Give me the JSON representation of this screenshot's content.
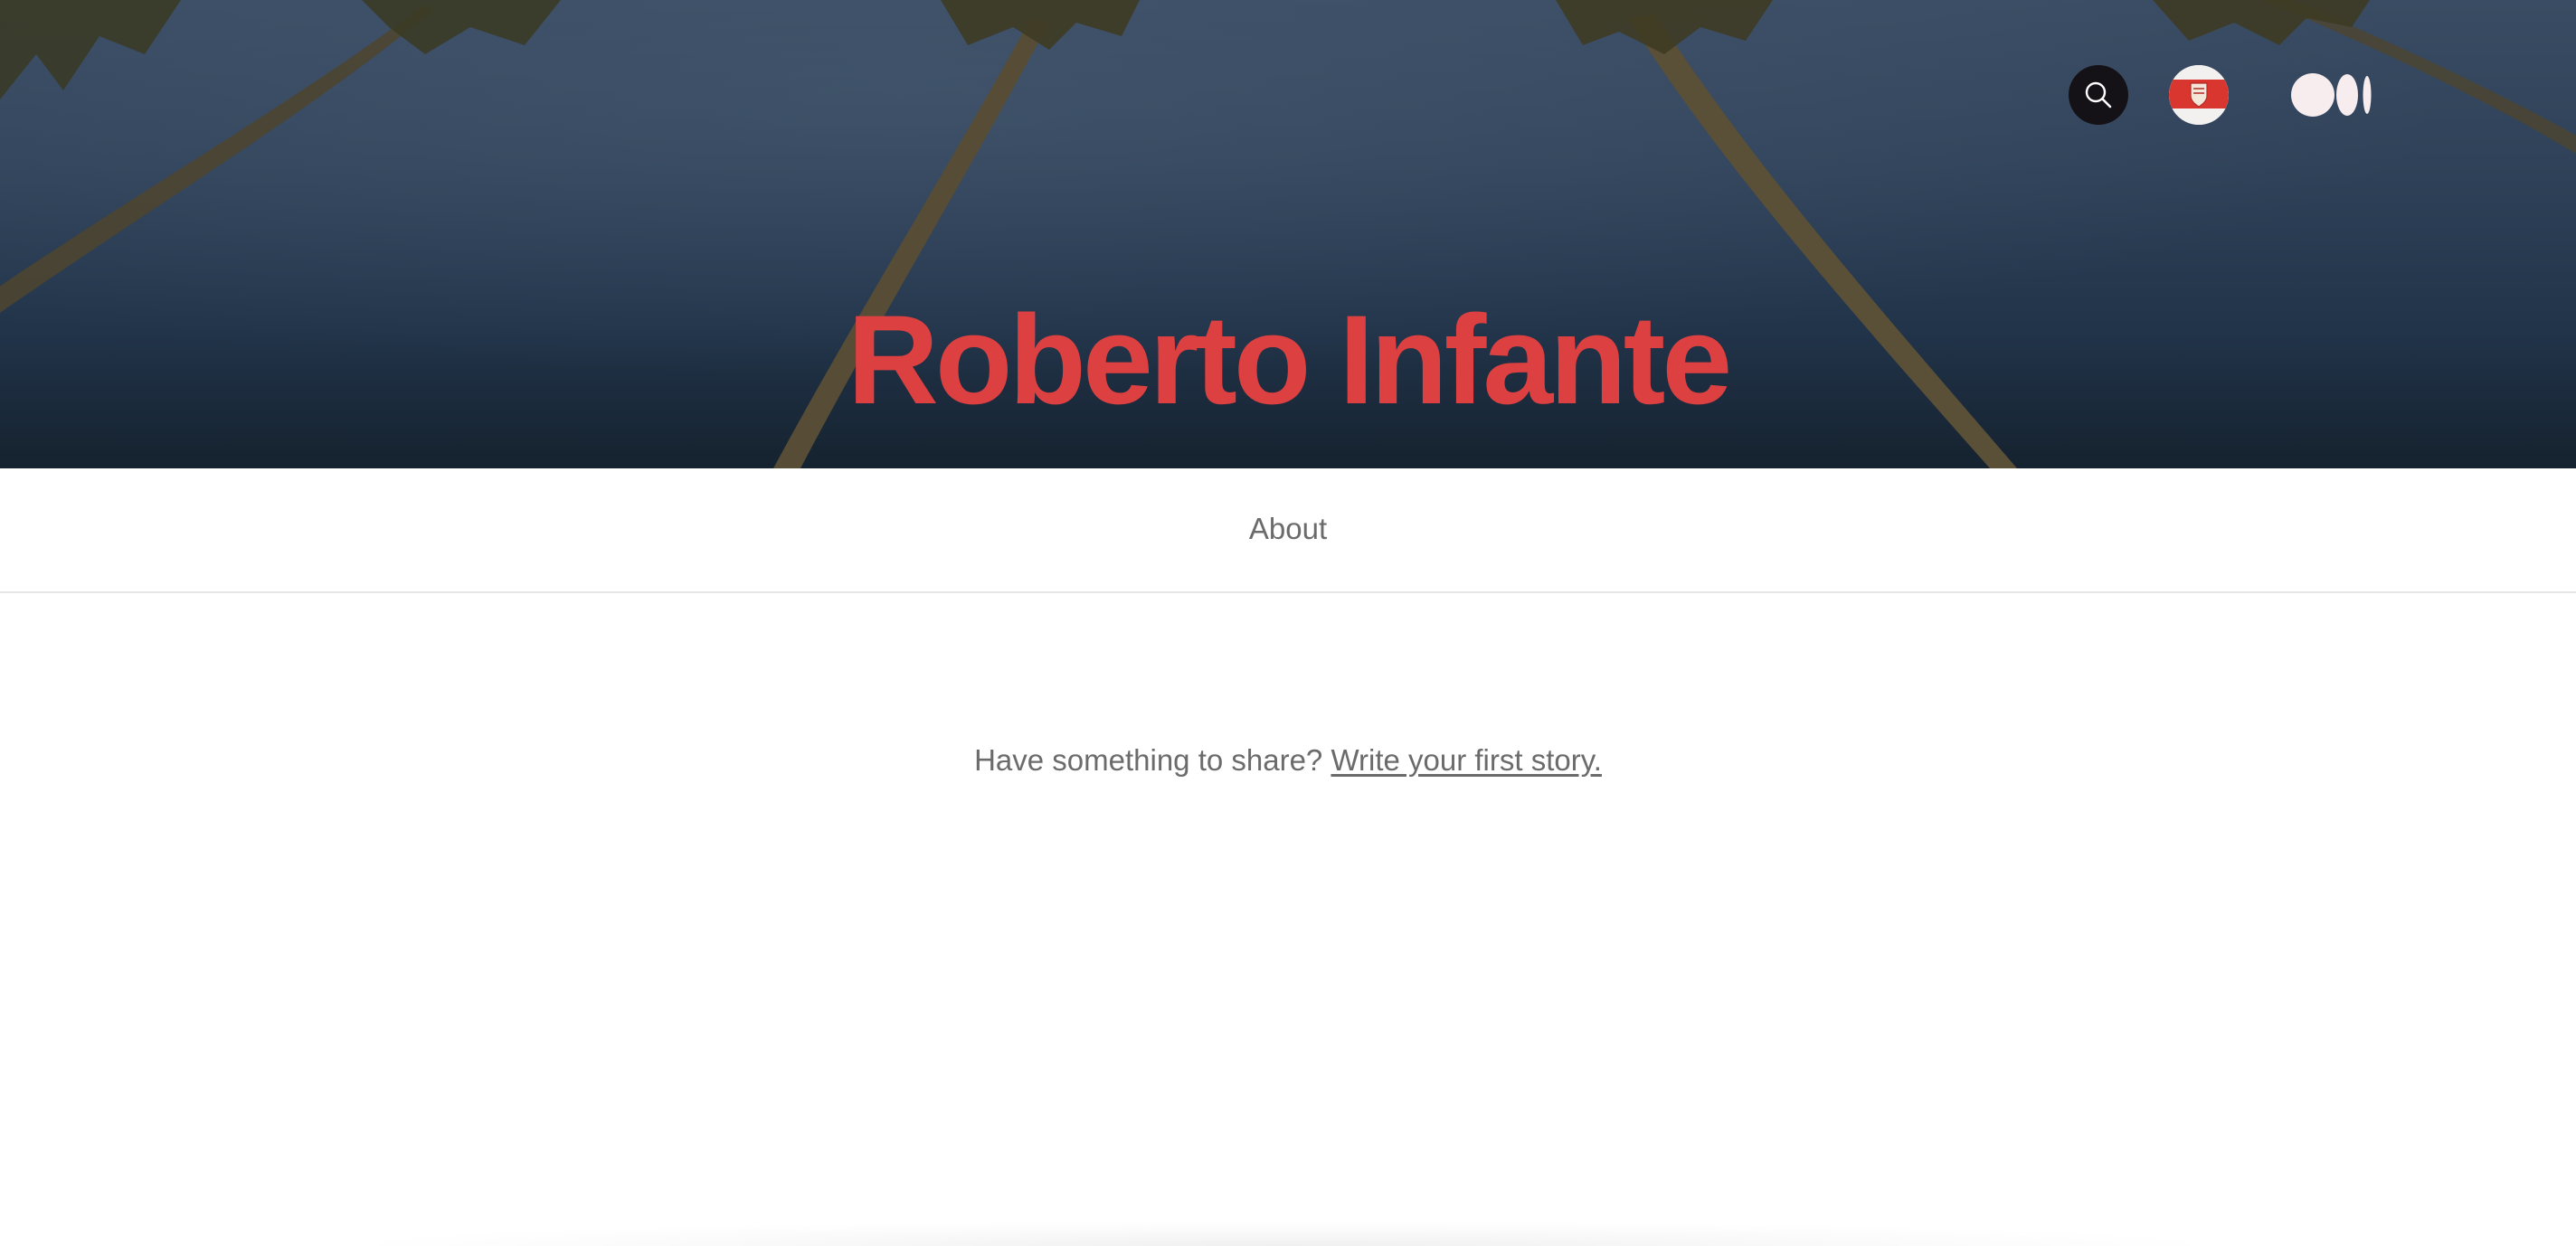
{
  "header": {
    "publication_title": "Roberto Infante",
    "search_icon": "search-icon",
    "avatar_icon": "avatar",
    "logo_icon": "medium-logo-icon"
  },
  "nav": {
    "about_label": "About"
  },
  "main": {
    "empty_prompt": "Have something to share?",
    "write_link": "Write your first story."
  },
  "colors": {
    "title": "#dd4041",
    "hero_sky": "#2f4259",
    "search_button_bg": "#141216",
    "muted_text": "#6b6b6b"
  }
}
